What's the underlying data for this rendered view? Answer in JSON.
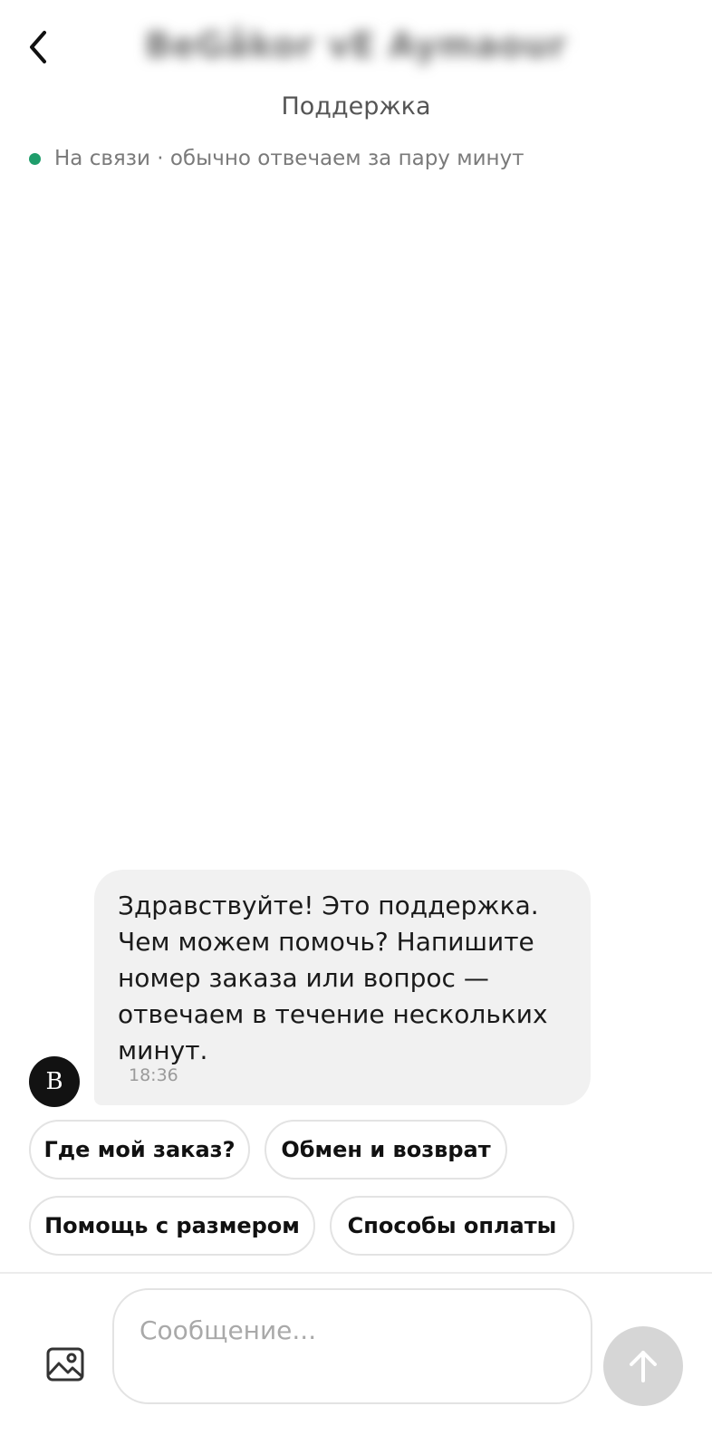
{
  "header": {
    "brand_title": "BeGåkor vE Aymaour",
    "subtitle": "Поддержка",
    "status_text": "На связи · обычно отвечаем за пару минут",
    "status_color": "#1f9d6b",
    "back_icon": "chevron-left-icon"
  },
  "chat": {
    "messages": [
      {
        "sender_initial": "B",
        "text": "Здравствуйте! Это поддержка. Чем можем помочь? Напишите номер заказа или вопрос — отвечаем в течение нескольких минут.",
        "time": "18:36"
      }
    ],
    "quick_replies": [
      "Где мой заказ?",
      "Обмен и возврат",
      "Помощь с размером",
      "Способы оплаты"
    ]
  },
  "composer": {
    "placeholder": "Сообщение...",
    "value": "",
    "attach_icon": "image-icon",
    "send_icon": "arrow-up-icon",
    "send_button_color": "#d6d6d6"
  }
}
